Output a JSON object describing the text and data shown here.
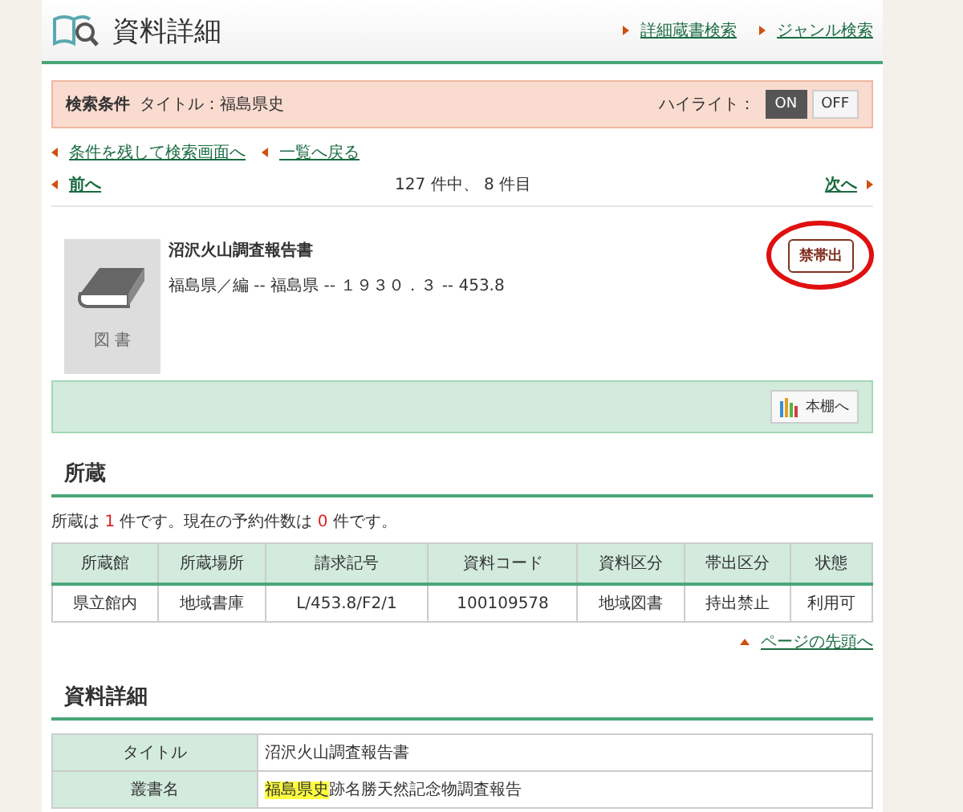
{
  "header": {
    "title": "資料詳細",
    "links": [
      "詳細蔵書検索",
      "ジャンル検索"
    ]
  },
  "search_conditions": {
    "label": "検索条件",
    "value": "タイトル：福島県史",
    "highlight_label": "ハイライト：",
    "toggle": [
      {
        "label": "ON",
        "selected": true
      },
      {
        "label": "OFF",
        "selected": false
      }
    ]
  },
  "nav_links": [
    "条件を残して検索画面へ",
    "一覧へ戻る"
  ],
  "pager": {
    "prev": "前へ",
    "position": "127 件中、 8 件目",
    "next": "次へ"
  },
  "item": {
    "type_label": "図 書",
    "title": "沼沢火山調査報告書",
    "details": "福島県／編 -- 福島県 -- １９３０．３ -- 453.8",
    "badge": "禁帯出",
    "badge_circled": true,
    "shelf_button": "本棚へ"
  },
  "holdings": {
    "heading": "所蔵",
    "summary": [
      {
        "text": "所蔵は ",
        "kind": "plain"
      },
      {
        "text": "1",
        "kind": "count"
      },
      {
        "text": " 件です。現在の予約件数は ",
        "kind": "plain"
      },
      {
        "text": "0",
        "kind": "count"
      },
      {
        "text": " 件です。",
        "kind": "plain"
      }
    ],
    "table": {
      "columns": [
        "所蔵館",
        "所蔵場所",
        "請求記号",
        "資料コード",
        "資料区分",
        "帯出区分",
        "状態"
      ],
      "rows": [
        [
          "県立館内",
          "地域書庫",
          "L/453.8/F2/1",
          "100109578",
          "地域図書",
          "持出禁止",
          "利用可"
        ]
      ]
    },
    "page_top_link": "ページの先頭へ"
  },
  "details": {
    "heading": "資料詳細",
    "rows": [
      {
        "label": "タイトル",
        "segments": [
          {
            "text": "沼沢火山調査報告書",
            "highlighted": false
          }
        ]
      },
      {
        "label": "叢書名",
        "segments": [
          {
            "text": "福島県史",
            "highlighted": true
          },
          {
            "text": "跡名勝天然記念物調査報告",
            "highlighted": false
          }
        ]
      }
    ]
  }
}
